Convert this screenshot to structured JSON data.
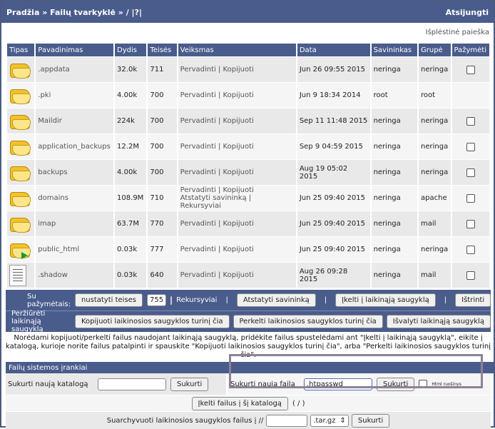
{
  "header": {
    "breadcrumb": "Pradžia » Failų tvarkyklė » / |?|",
    "logout": "Atsijungti"
  },
  "advanced_search": "Išplėstinė paieška",
  "columns": [
    "Tipas",
    "Pavadinimas",
    "Dydis",
    "Teisės",
    "Veiksmas",
    "Data",
    "Savininkas",
    "Grupė",
    "Pažymėti"
  ],
  "files": [
    {
      "icon": "folder-icon",
      "name": ".appdata",
      "size": "32.0k",
      "perm": "711",
      "a1": "Pervadinti",
      "sep1": "|",
      "a2": "Kopijuoti",
      "a3": "",
      "sep2": "",
      "a4": "",
      "date": "Jun 26 09:55 2015",
      "owner": "neringa",
      "group": "neringa",
      "checkbox": true
    },
    {
      "icon": "folder-icon",
      "name": ".pki",
      "size": "4.00k",
      "perm": "700",
      "a1": "Pervadinti",
      "sep1": "|",
      "a2": "Kopijuoti",
      "a3": "",
      "sep2": "",
      "a4": "",
      "date": "Jun 9 18:34 2014",
      "owner": "root",
      "group": "root",
      "checkbox": false
    },
    {
      "icon": "folder-icon",
      "name": "Maildir",
      "size": "224k",
      "perm": "700",
      "a1": "Pervadinti",
      "sep1": "|",
      "a2": "Kopijuoti",
      "a3": "",
      "sep2": "",
      "a4": "",
      "date": "Sep 11 11:48 2015",
      "owner": "neringa",
      "group": "neringa",
      "checkbox": true
    },
    {
      "icon": "folder-icon",
      "name": "application_backups",
      "size": "12.2M",
      "perm": "700",
      "a1": "Pervadinti",
      "sep1": "|",
      "a2": "Kopijuoti",
      "a3": "",
      "sep2": "",
      "a4": "",
      "date": "Sep 9 04:59 2015",
      "owner": "neringa",
      "group": "neringa",
      "checkbox": true
    },
    {
      "icon": "folder-icon",
      "name": "backups",
      "size": "4.00k",
      "perm": "700",
      "a1": "Pervadinti",
      "sep1": "|",
      "a2": "Kopijuoti",
      "a3": "",
      "sep2": "",
      "a4": "",
      "date": "Aug 19 05:02 2015",
      "owner": "neringa",
      "group": "neringa",
      "checkbox": true
    },
    {
      "icon": "folder-icon",
      "name": "domains",
      "size": "108.9M",
      "perm": "710",
      "a1": "Pervadinti",
      "sep1": "|",
      "a2": "Kopijuoti",
      "a3": "Atstatyti savininką",
      "sep2": "|",
      "a4": "Rekursyviai",
      "date": "Jun 25 09:40 2015",
      "owner": "neringa",
      "group": "apache",
      "checkbox": true
    },
    {
      "icon": "folder-icon",
      "name": "imap",
      "size": "63.7M",
      "perm": "770",
      "a1": "Pervadinti",
      "sep1": "|",
      "a2": "Kopijuoti",
      "a3": "",
      "sep2": "",
      "a4": "",
      "date": "Jun 25 09:40 2015",
      "owner": "neringa",
      "group": "mail",
      "checkbox": true
    },
    {
      "icon": "folder-link-icon",
      "name": "public_html",
      "size": "0.03k",
      "perm": "777",
      "a1": "Pervadinti",
      "sep1": "|",
      "a2": "Kopijuoti",
      "a3": "",
      "sep2": "",
      "a4": "",
      "date": "Jun 25 09:40 2015",
      "owner": "neringa",
      "group": "neringa",
      "checkbox": true
    },
    {
      "icon": "text-file-icon",
      "name": ".shadow",
      "size": "0.03k",
      "perm": "640",
      "a1": "Pervadinti",
      "sep1": "|",
      "a2": "Kopijuoti",
      "a3": "",
      "sep2": "",
      "a4": "",
      "date": "Aug 26 09:28 2015",
      "owner": "neringa",
      "group": "mail",
      "checkbox": true
    }
  ],
  "selected_bar": {
    "label": "Su pažymėtais:",
    "set_perm_button": "nustatyti teises",
    "perm_value": "755",
    "recursive_label": "Rekursyviai",
    "sep": "|",
    "reset_owner_button": "Atstatyti savininką",
    "to_clipboard_button": "Įkelti į laikinąją saugyklą",
    "delete_button": "Ištrinti"
  },
  "clipboard_bar": {
    "view_label": "Peržiūrėti laikinąją saugyklą",
    "copy_button": "Kopijuoti laikinosios saugyklos turinį čia",
    "move_button": "Perkelti laikinosios saugyklos turinį čia",
    "clear_button": "Išvalyti laikinąją saugyklą"
  },
  "note": "Norėdami kopijuoti/perkelti failus naudojant laikinąją saugyklą, pridėkite failus spustelėdami ant \"Įkelti į laikinąją saugyklą\", eikite į katalogą, kurioje norite failus patalpinti ir spauskite \"Kopijuoti laikinosios saugyklos turinį čia\", arba \"Perkelti laikinosios saugyklos turinį čia\".",
  "tools": {
    "header": "Failų sistemos įrankiai",
    "create_dir_label": "Sukurti naują katalogą",
    "create_dir_value": "",
    "create_dir_button": "Sukurti",
    "create_file_label": "Sukurti naują failą",
    "create_file_value": ".htpasswd",
    "create_file_button": "Sukurti",
    "html_editor_label": "Html ruošinys",
    "upload_button": "Įkelti failus į šį katalogą",
    "upload_path": "( / )",
    "archive_label": "Suarchyvuoti laikinosios saugyklos failus į //",
    "archive_value": "",
    "archive_ext": ".tar.gz",
    "archive_button": "Sukurti"
  }
}
